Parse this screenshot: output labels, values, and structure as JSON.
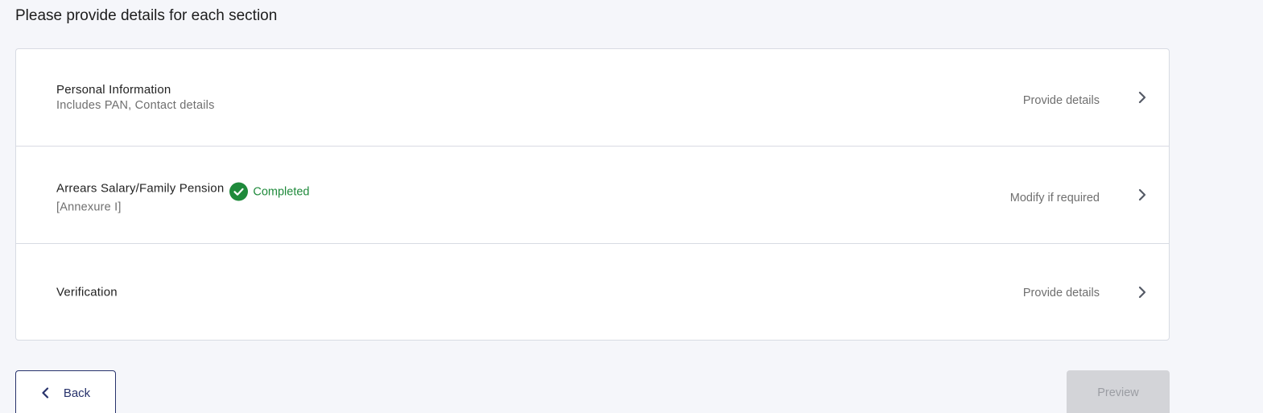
{
  "page": {
    "title": "Please provide details for each section"
  },
  "sections": [
    {
      "title": "Personal Information",
      "subtitle": "Includes PAN, Contact details",
      "action": "Provide details",
      "icon": "chevron-right-icon"
    },
    {
      "title": "Arrears Salary/Family Pension",
      "subtitle": "[Annexure I]",
      "badge": "Completed",
      "badge_icon": "check-circle-icon",
      "action": "Modify if required",
      "icon": "chevron-right-icon"
    },
    {
      "title": "Verification",
      "action": "Provide details",
      "icon": "chevron-right-icon"
    }
  ],
  "footer": {
    "back_label": "Back",
    "back_icon": "chevron-left-icon",
    "preview_label": "Preview"
  },
  "colors": {
    "completed_green": "#1f8a3b",
    "primary_navy": "#27326b",
    "disabled_gray": "#d3d4d8"
  }
}
